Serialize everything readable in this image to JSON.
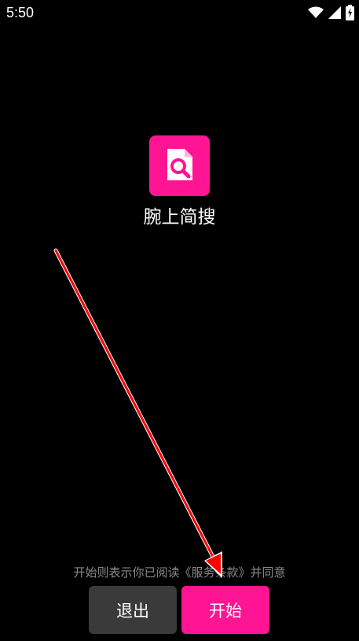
{
  "status_bar": {
    "time": "5:50",
    "icons": [
      "wifi-icon",
      "signal-icon",
      "battery-charging-icon"
    ]
  },
  "app": {
    "icon": "document-search-icon",
    "name": "腕上简搜"
  },
  "footer": {
    "terms_text": "开始则表示你已阅读《服务条款》并同意",
    "exit_label": "退出",
    "start_label": "开始"
  },
  "annotation": {
    "type": "arrow",
    "color": "#ff0000"
  },
  "colors": {
    "background": "#000000",
    "accent": "#ff1493",
    "secondary_button": "#3a3a3a",
    "muted_text": "#8a8a8a"
  }
}
